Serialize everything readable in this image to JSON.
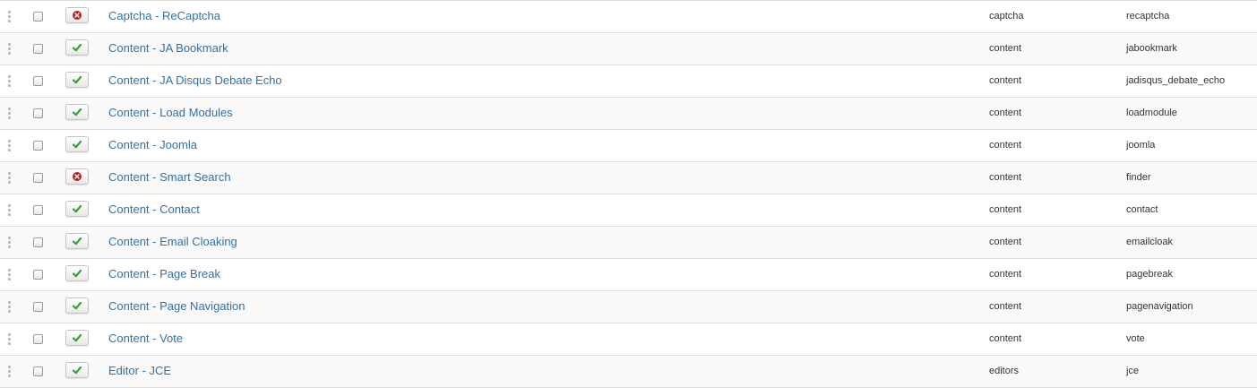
{
  "plugins": {
    "rows": [
      {
        "name": "Captcha - ReCaptcha",
        "folder": "captcha",
        "element": "recaptcha",
        "status": "disabled"
      },
      {
        "name": "Content - JA Bookmark",
        "folder": "content",
        "element": "jabookmark",
        "status": "enabled"
      },
      {
        "name": "Content - JA Disqus Debate Echo",
        "folder": "content",
        "element": "jadisqus_debate_echo",
        "status": "enabled"
      },
      {
        "name": "Content - Load Modules",
        "folder": "content",
        "element": "loadmodule",
        "status": "enabled"
      },
      {
        "name": "Content - Joomla",
        "folder": "content",
        "element": "joomla",
        "status": "enabled"
      },
      {
        "name": "Content - Smart Search",
        "folder": "content",
        "element": "finder",
        "status": "disabled"
      },
      {
        "name": "Content - Contact",
        "folder": "content",
        "element": "contact",
        "status": "enabled"
      },
      {
        "name": "Content - Email Cloaking",
        "folder": "content",
        "element": "emailcloak",
        "status": "enabled"
      },
      {
        "name": "Content - Page Break",
        "folder": "content",
        "element": "pagebreak",
        "status": "enabled"
      },
      {
        "name": "Content - Page Navigation",
        "folder": "content",
        "element": "pagenavigation",
        "status": "enabled"
      },
      {
        "name": "Content - Vote",
        "folder": "content",
        "element": "vote",
        "status": "enabled"
      },
      {
        "name": "Editor - JCE",
        "folder": "editors",
        "element": "jce",
        "status": "enabled"
      }
    ]
  },
  "icons": {
    "enabled": "check-icon",
    "disabled": "unpublished-icon",
    "drag": "drag-handle-icon"
  },
  "colors": {
    "link": "#3071a9",
    "enabled_icon": "#3c9e3c",
    "disabled_icon": "#b22222",
    "row_alt": "#f9f9f9",
    "border": "#dddddd"
  }
}
